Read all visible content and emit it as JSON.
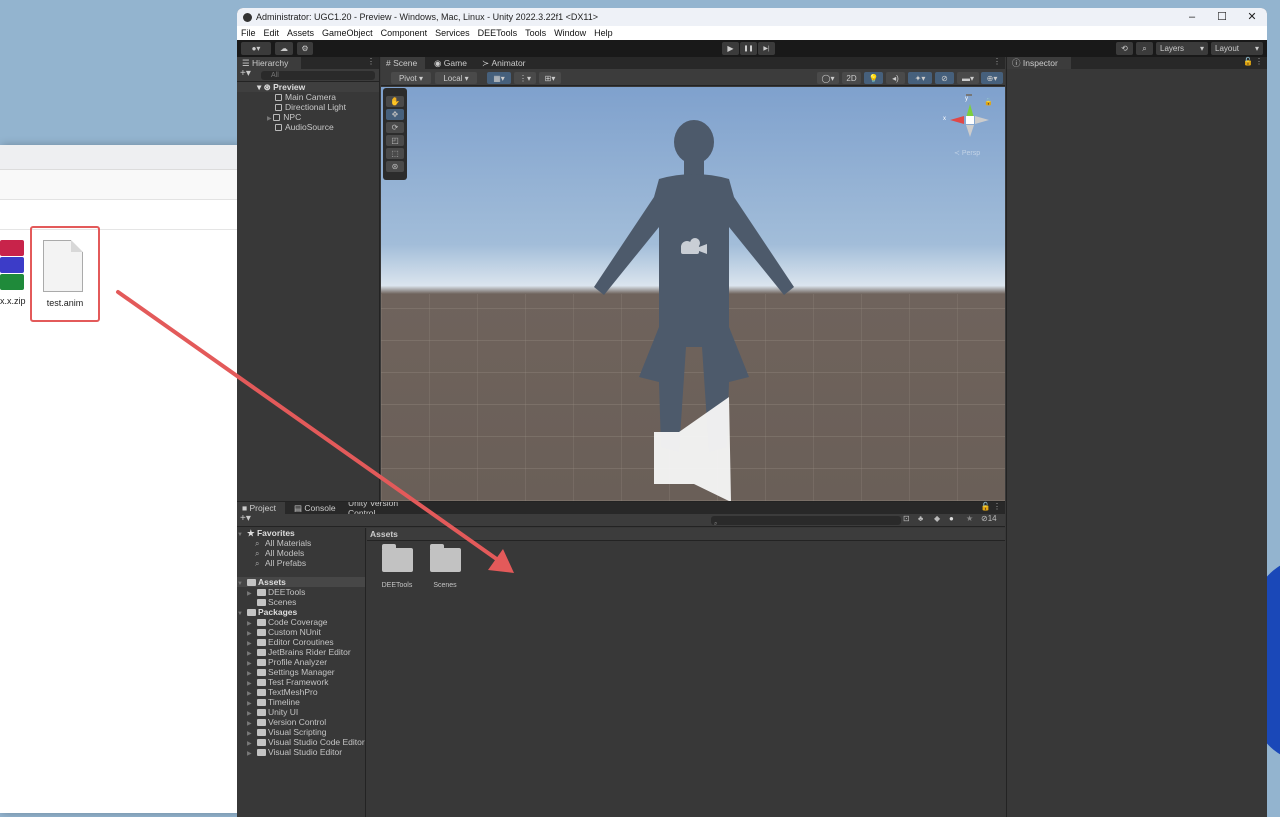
{
  "desktop": {
    "accent": "#93b4cf"
  },
  "explorer": {
    "files": [
      {
        "name": "x.x.zip",
        "icon": "winrar-archive-icon"
      },
      {
        "name": "test.anim",
        "icon": "blank-file-icon",
        "highlighted": true
      }
    ],
    "highlight_color": "#e35a5a"
  },
  "unity": {
    "title": "Administrator: UGC1.20 - Preview - Windows, Mac, Linux - Unity 2022.3.22f1 <DX11>",
    "window_controls": [
      "–",
      "☐",
      "✕"
    ],
    "menu": [
      "File",
      "Edit",
      "Assets",
      "GameObject",
      "Component",
      "Services",
      "DEETools",
      "Tools",
      "Window",
      "Help"
    ],
    "toolbar": {
      "account_icon": "account-icon",
      "cloud_icon": "cloud-icon",
      "collab_icon": "services-icon",
      "play": "▶",
      "pause": "❚❚",
      "step": "▶|",
      "history_icon": "history-icon",
      "search_icon": "search-icon",
      "layers": "Layers",
      "layout": "Layout"
    },
    "hierarchy": {
      "tab": "Hierarchy",
      "search_placeholder": "All",
      "scene": "Preview",
      "items": [
        {
          "label": "Main Camera",
          "has_children": false
        },
        {
          "label": "Directional Light",
          "has_children": false
        },
        {
          "label": "NPC",
          "has_children": true
        },
        {
          "label": "AudioSource",
          "has_children": false
        }
      ]
    },
    "scene": {
      "tabs": [
        "Scene",
        "Game",
        "Animator"
      ],
      "active_tab": "Scene",
      "pivot": "Pivot",
      "local": "Local",
      "mode_2d": "2D",
      "persp": "Persp",
      "axis_x": "x",
      "axis_y": "y",
      "tools": [
        "hand-tool",
        "move-tool",
        "rotate-tool",
        "scale-tool",
        "rect-tool",
        "transform-tool"
      ],
      "active_tool": "move-tool"
    },
    "inspector": {
      "tab": "Inspector"
    },
    "project": {
      "tabs": [
        "Project",
        "Console",
        "Unity Version Control"
      ],
      "active_tab": "Project",
      "hidden_count": "14",
      "favorites": {
        "label": "Favorites",
        "items": [
          "All Materials",
          "All Models",
          "All Prefabs"
        ]
      },
      "assets": {
        "label": "Assets",
        "items": [
          {
            "label": "DEETools",
            "expandable": true
          },
          {
            "label": "Scenes",
            "expandable": false
          }
        ]
      },
      "packages": {
        "label": "Packages",
        "items": [
          "Code Coverage",
          "Custom NUnit",
          "Editor Coroutines",
          "JetBrains Rider Editor",
          "Profile Analyzer",
          "Settings Manager",
          "Test Framework",
          "TextMeshPro",
          "Timeline",
          "Unity UI",
          "Version Control",
          "Visual Scripting",
          "Visual Studio Code Editor",
          "Visual Studio Editor"
        ]
      },
      "breadcrumb": "Assets",
      "grid": [
        "DEETools",
        "Scenes"
      ]
    }
  },
  "annotation": {
    "type": "drag-arrow",
    "from": "test.anim",
    "to": "Assets folder",
    "color": "#e35a5a"
  }
}
